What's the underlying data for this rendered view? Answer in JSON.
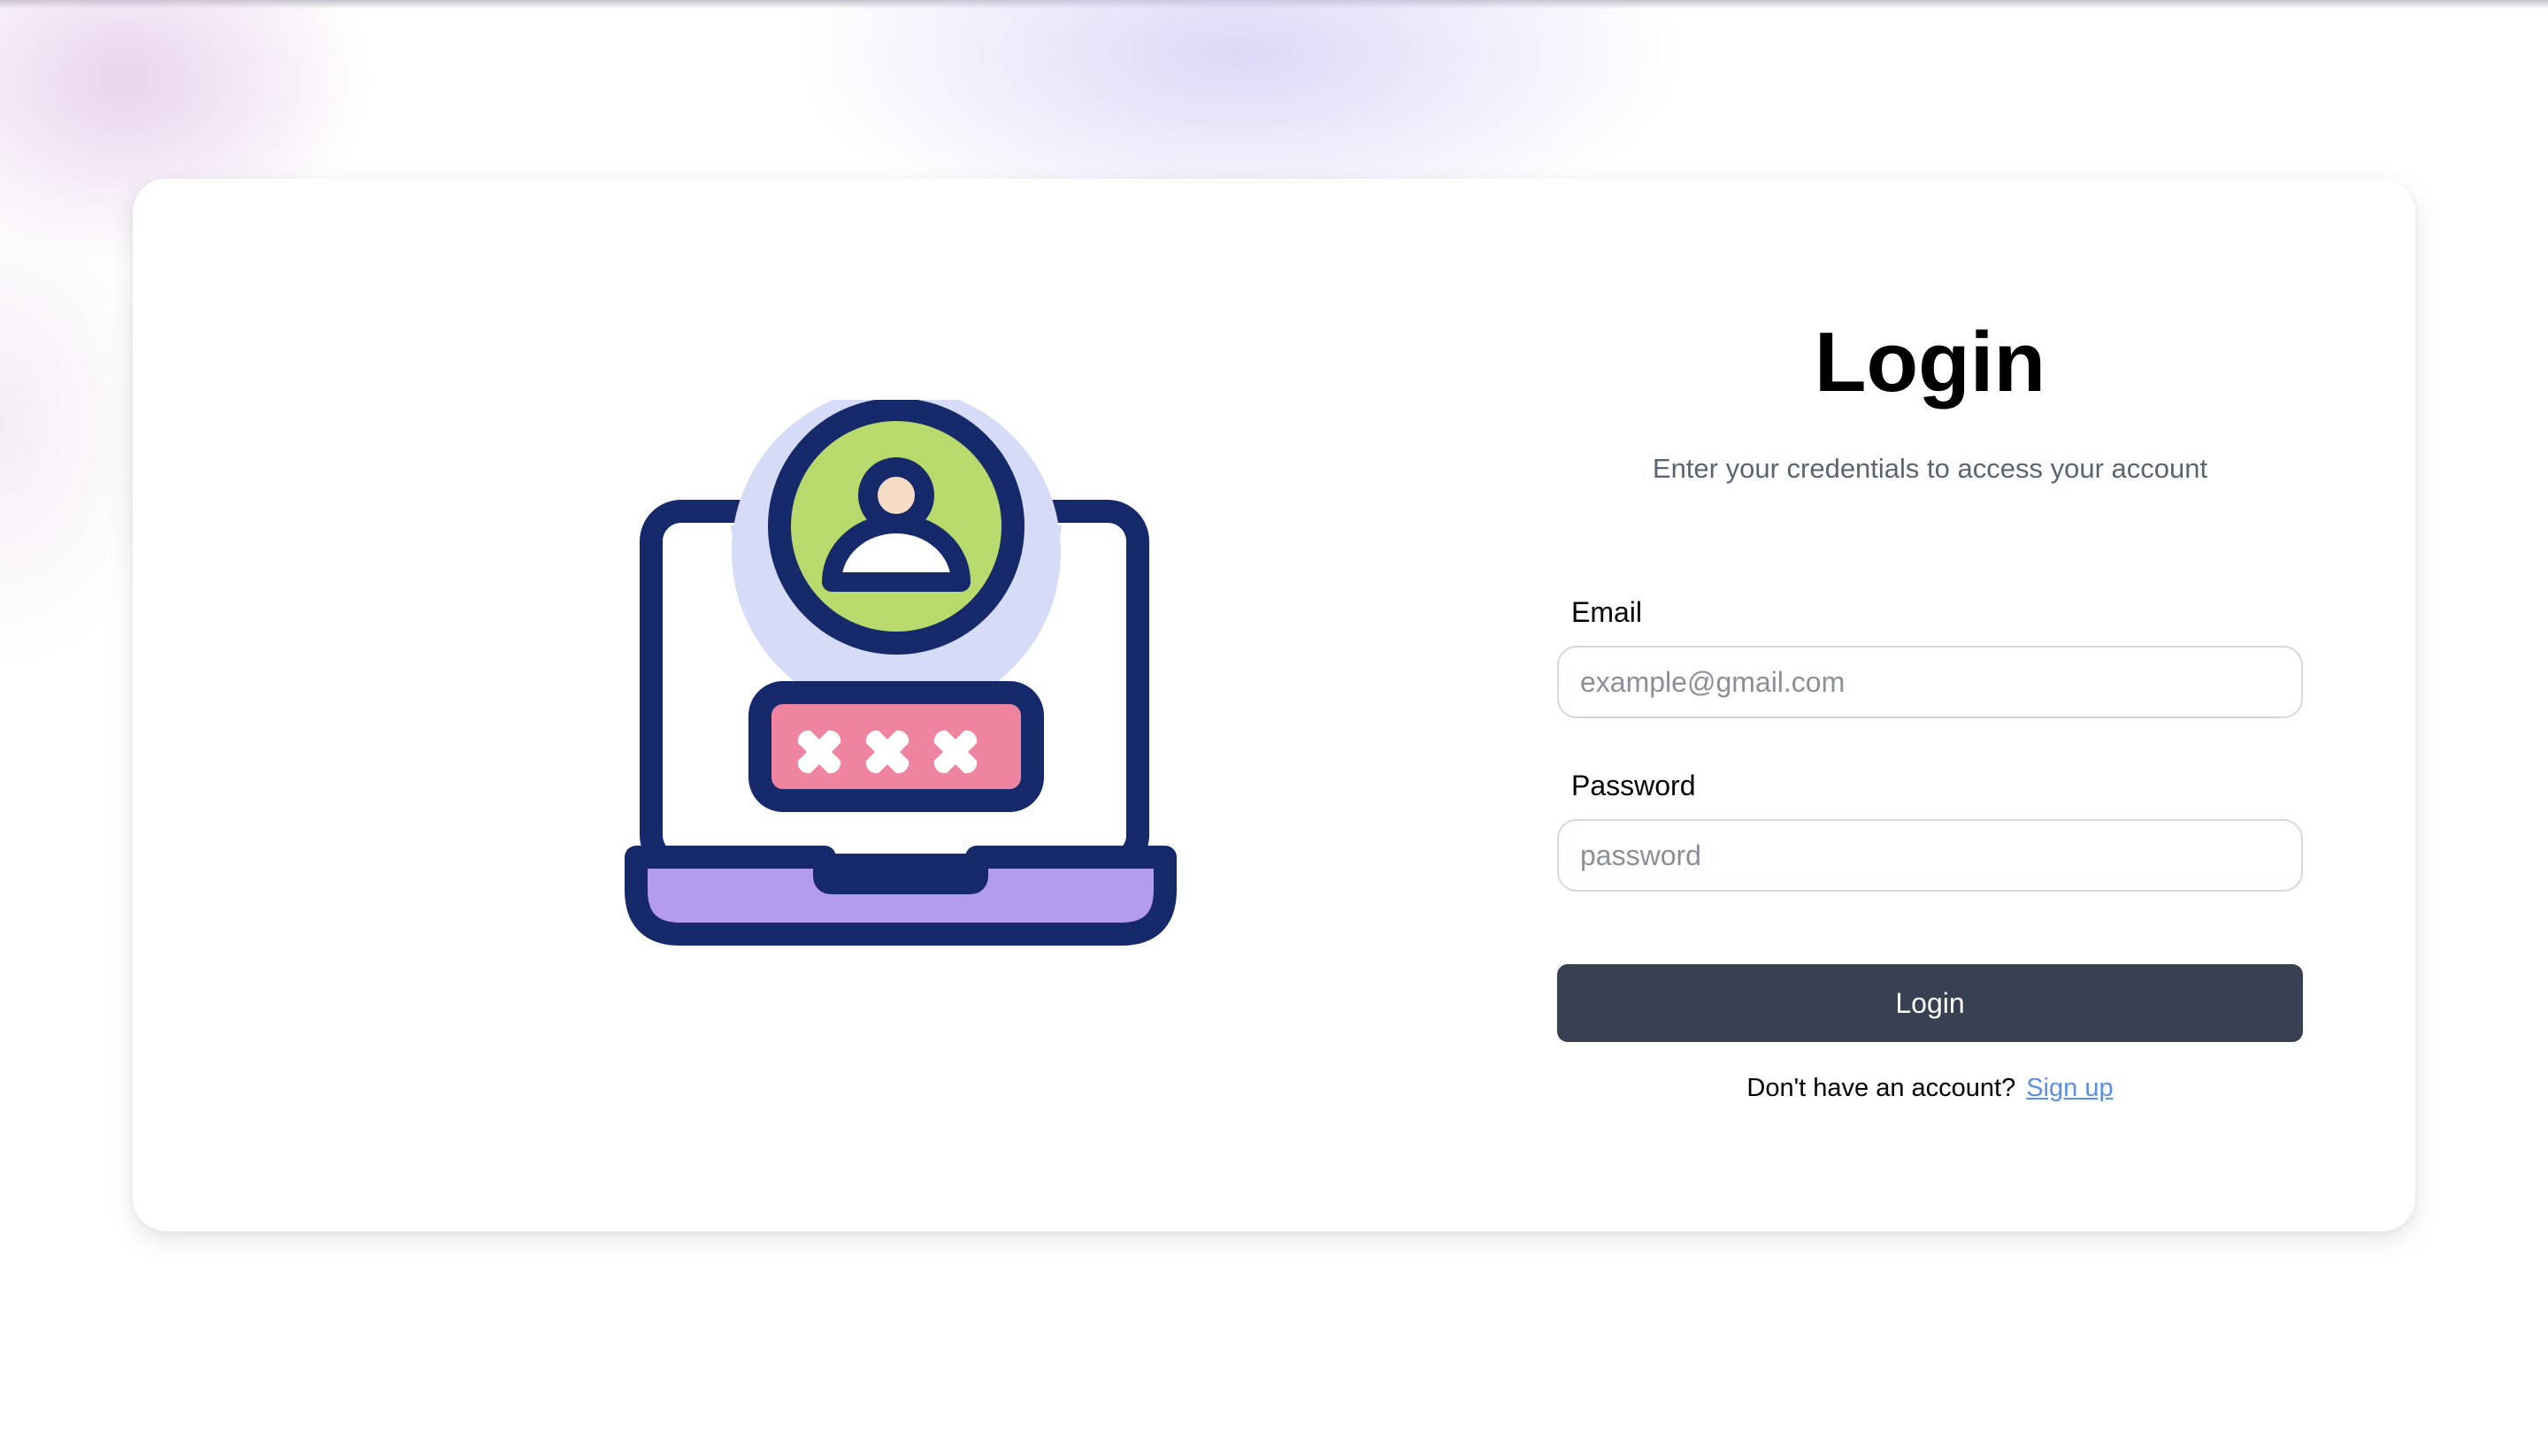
{
  "login": {
    "title": "Login",
    "subtitle": "Enter your credentials to access your account",
    "email": {
      "label": "Email",
      "placeholder": "example@gmail.com",
      "value": ""
    },
    "password": {
      "label": "Password",
      "placeholder": "password",
      "value": ""
    },
    "submit_label": "Login",
    "signup_prompt": "Don't have an account?",
    "signup_link": "Sign up"
  },
  "illustration": {
    "icon": "laptop-user-login-icon"
  },
  "colors": {
    "illustration_outline": "#15296b",
    "avatar_circle": "#b8d96b",
    "avatar_halo": "#d6dcf7",
    "avatar_skin": "#f6dcc4",
    "password_field": "#ee84a0",
    "laptop_base": "#b59bec",
    "button_bg": "#374151",
    "link": "#5b8fe0",
    "subtitle": "#5b6473"
  }
}
